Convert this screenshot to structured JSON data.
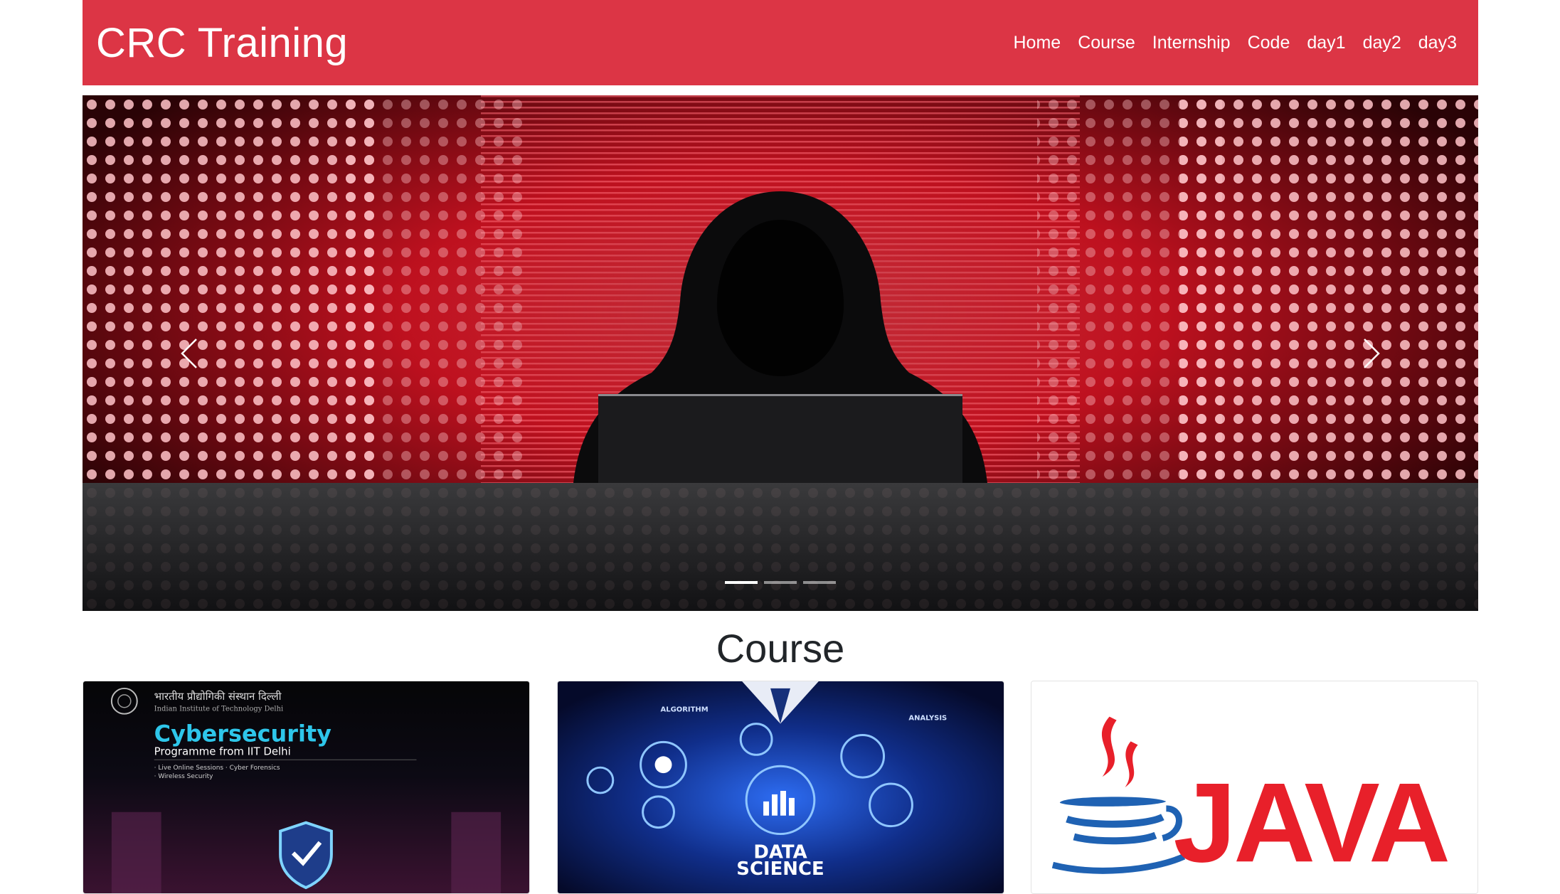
{
  "navbar": {
    "brand": "CRC Training",
    "links": [
      "Home",
      "Course",
      "Internship",
      "Code",
      "day1",
      "day2",
      "day3"
    ]
  },
  "carousel": {
    "slide_count": 3,
    "active_index": 0,
    "prev_icon": "chevron-left-icon",
    "next_icon": "chevron-right-icon"
  },
  "course": {
    "heading": "Course",
    "cards": [
      {
        "institute_hindi": "भारतीय प्रौद्योगिकी संस्थान दिल्ली",
        "institute": "Indian Institute of Technology Delhi",
        "title": "Cybersecurity",
        "subtitle": "Programme from IIT Delhi",
        "bullet1": "· Live Online Sessions · Cyber Forensics",
        "bullet2": "· Wireless Security"
      },
      {
        "label_left": "ALGORITHM",
        "label_right": "ANALYSIS",
        "title_line1": "DATA",
        "title_line2": "SCIENCE"
      },
      {
        "title": "JAVA"
      }
    ]
  },
  "colors": {
    "brand_red": "#dc3545",
    "java_red": "#e8202a",
    "java_blue": "#1f62b3"
  }
}
